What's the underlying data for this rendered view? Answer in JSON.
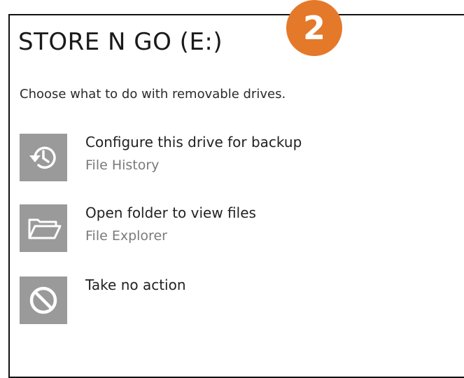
{
  "dialog": {
    "title": "STORE N GO (E:)",
    "prompt": "Choose what to do with removable drives."
  },
  "options": [
    {
      "label": "Configure this drive for backup",
      "app": "File History",
      "icon": "history-clock-icon"
    },
    {
      "label": "Open folder to view files",
      "app": "File Explorer",
      "icon": "folder-open-icon"
    },
    {
      "label": "Take no action",
      "app": "",
      "icon": "no-action-icon"
    }
  ],
  "callout": {
    "number": "2",
    "color": "#e4792a"
  },
  "colors": {
    "icon_tile": "#9a9a9a",
    "secondary_text": "#7a7a7a"
  }
}
